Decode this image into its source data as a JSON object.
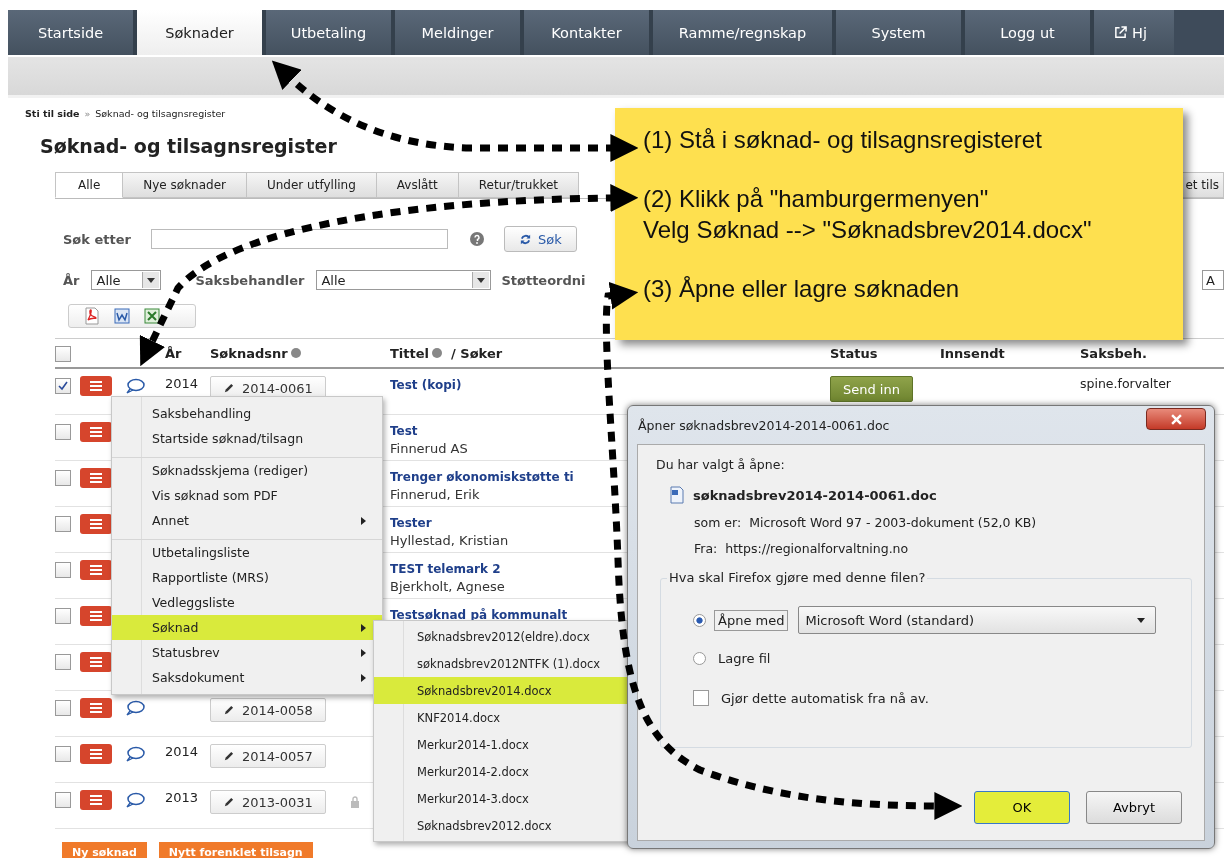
{
  "nav": [
    {
      "label": "Startside",
      "selected": false,
      "kind": "plain"
    },
    {
      "label": "Søknader",
      "selected": true,
      "kind": "plain"
    },
    {
      "label": "Utbetaling",
      "selected": false,
      "kind": "plain"
    },
    {
      "label": "Meldinger",
      "selected": false,
      "kind": "plain"
    },
    {
      "label": "Kontakter",
      "selected": false,
      "kind": "plain"
    },
    {
      "label": "Ramme/regnskap",
      "selected": false,
      "kind": "plain"
    },
    {
      "label": "System",
      "selected": false,
      "kind": "plain"
    },
    {
      "label": "Logg ut",
      "selected": false,
      "kind": "plain"
    },
    {
      "label": "Hj",
      "selected": false,
      "kind": "external"
    }
  ],
  "breadcrumb": {
    "root": "Sti til side",
    "separator": "»",
    "current": "Søknad- og tilsagnsregister"
  },
  "title": "Søknad- og tilsagnsregister",
  "tabs": [
    {
      "label": "Alle",
      "selected": true
    },
    {
      "label": "Nye søknader",
      "selected": false
    },
    {
      "label": "Under utfylling",
      "selected": false
    },
    {
      "label": "Avslått",
      "selected": false
    },
    {
      "label": "Retur/trukket",
      "selected": false
    },
    {
      "label": "et tils",
      "selected": false
    }
  ],
  "search": {
    "label": "Søk etter",
    "button": "Søk"
  },
  "filters": {
    "year_label": "År",
    "year_value": "Alle",
    "handler_label": "Saksbehandler",
    "handler_value": "Alle",
    "scheme_label": "Støtteordni",
    "scheme_value": "A"
  },
  "table": {
    "select_all": false,
    "columns": [
      {
        "label": "År",
        "help": false
      },
      {
        "label": "Søknadsnr",
        "help": true
      },
      {
        "label": "Tittel",
        "help": true,
        "suffix": "/ Søker"
      },
      {
        "label": "Status",
        "help": false
      },
      {
        "label": "Innsendt",
        "help": false
      },
      {
        "label": "Saksbeh.",
        "help": false
      }
    ],
    "rows": [
      {
        "checked": true,
        "comment": true,
        "year": "2014",
        "number": "2014-0061",
        "title": "Test (kopi)",
        "status": "Send inn",
        "officer": "spine.forvalter"
      },
      {
        "checked": false,
        "comment": false,
        "title": "Test",
        "applicant": "Finnerud AS"
      },
      {
        "checked": false,
        "comment": false,
        "title": "Trenger økonomiskstøtte ti",
        "applicant": "Finnerud, Erik"
      },
      {
        "checked": false,
        "comment": false,
        "title": "Tester",
        "applicant": "Hyllestad, Kristian"
      },
      {
        "checked": false,
        "comment": false,
        "title": "TEST telemark 2",
        "applicant": "Bjerkholt, Agnese"
      },
      {
        "checked": false,
        "comment": false,
        "title": "Testsøknad på kommunalt"
      },
      {
        "checked": false,
        "comment": false
      },
      {
        "checked": false,
        "comment": true,
        "number": "2014-0058"
      },
      {
        "checked": false,
        "comment": true,
        "year": "2014",
        "number": "2014-0057"
      },
      {
        "checked": false,
        "comment": true,
        "year": "2013",
        "number": "2013-0031",
        "locked": true
      }
    ]
  },
  "footer_buttons": [
    "Ny søknad",
    "Nytt forenklet tilsagn"
  ],
  "menu": {
    "items": [
      {
        "label": "Saksbehandling",
        "submenu": false,
        "selected": false,
        "divider": false
      },
      {
        "label": "Startside søknad/tilsagn",
        "submenu": false,
        "selected": false,
        "divider": false
      },
      {
        "label": "Søknadsskjema (rediger)",
        "submenu": false,
        "selected": false,
        "divider": true
      },
      {
        "label": "Vis søknad som PDF",
        "submenu": false,
        "selected": false,
        "divider": false
      },
      {
        "label": "Annet",
        "submenu": true,
        "selected": false,
        "divider": false
      },
      {
        "label": "Utbetalingsliste",
        "submenu": false,
        "selected": false,
        "divider": true
      },
      {
        "label": "Rapportliste (MRS)",
        "submenu": false,
        "selected": false,
        "divider": false
      },
      {
        "label": "Vedleggsliste",
        "submenu": false,
        "selected": false,
        "divider": false
      },
      {
        "label": "Søknad",
        "submenu": true,
        "selected": true,
        "divider": false
      },
      {
        "label": "Statusbrev",
        "submenu": true,
        "selected": false,
        "divider": false
      },
      {
        "label": "Saksdokument",
        "submenu": true,
        "selected": false,
        "divider": false
      }
    ]
  },
  "submenu": {
    "items": [
      {
        "label": "Søknadsbrev2012(eldre).docx",
        "selected": false
      },
      {
        "label": "søknadsbrev2012NTFK (1).docx",
        "selected": false
      },
      {
        "label": "Søknadsbrev2014.docx",
        "selected": true
      },
      {
        "label": "KNF2014.docx",
        "selected": false
      },
      {
        "label": "Merkur2014-1.docx",
        "selected": false
      },
      {
        "label": "Merkur2014-2.docx",
        "selected": false
      },
      {
        "label": "Merkur2014-3.docx",
        "selected": false
      },
      {
        "label": "Søknadsbrev2012.docx",
        "selected": false
      }
    ]
  },
  "dialog": {
    "title": "Åpner søknadsbrev2014-2014-0061.doc",
    "intro": "Du har valgt å åpne:",
    "filename": "søknadsbrev2014-2014-0061.doc",
    "type_label": "som er:",
    "type_value": "Microsoft Word 97 - 2003-dokument (52,0 KB)",
    "from_label": "Fra:",
    "from_value": "https://regionalforvaltning.no",
    "question": "Hva skal Firefox gjøre med denne filen?",
    "options": [
      {
        "label": "Åpne med",
        "selected": true,
        "app": "Microsoft Word (standard)"
      },
      {
        "label": "Lagre fil",
        "selected": false
      }
    ],
    "auto": {
      "label": "Gjør dette automatisk fra nå av.",
      "checked": false
    },
    "buttons": [
      {
        "label": "OK",
        "highlighted": true
      },
      {
        "label": "Avbryt",
        "highlighted": false
      }
    ]
  },
  "callout": {
    "steps": [
      {
        "lines": [
          "(1) Stå i søknad- og tilsagnsregisteret"
        ]
      },
      {
        "lines": [
          "(2) Klikk på \"hamburgermenyen\"",
          "Velg Søknad --> \"Søknadsbrev2014.docx\""
        ]
      },
      {
        "lines": [
          "(3) Åpne eller lagre søknaden"
        ]
      }
    ]
  }
}
